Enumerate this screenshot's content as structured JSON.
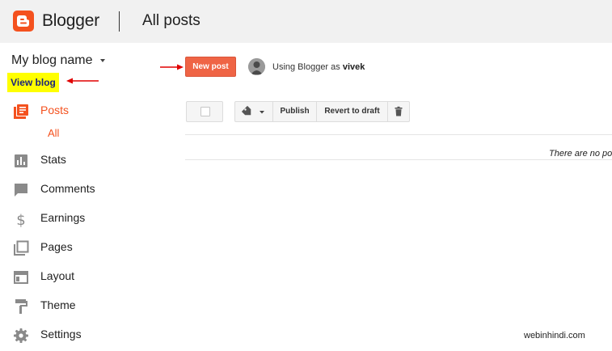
{
  "header": {
    "brand": "Blogger",
    "page_title": "All posts",
    "logo_icon": "blogger-logo-icon",
    "background": "#f1f1f1"
  },
  "sidebar": {
    "blog_name": "My blog name",
    "view_blog": "View blog",
    "items": [
      {
        "label": "Posts",
        "icon": "posts-icon",
        "active": true
      },
      {
        "label": "Stats",
        "icon": "stats-icon",
        "active": false
      },
      {
        "label": "Comments",
        "icon": "comments-icon",
        "active": false
      },
      {
        "label": "Earnings",
        "icon": "dollar-icon",
        "active": false
      },
      {
        "label": "Pages",
        "icon": "pages-icon",
        "active": false
      },
      {
        "label": "Layout",
        "icon": "layout-icon",
        "active": false
      },
      {
        "label": "Theme",
        "icon": "paint-roller-icon",
        "active": false
      },
      {
        "label": "Settings",
        "icon": "gear-icon",
        "active": false
      }
    ],
    "posts_subitem": "All"
  },
  "main": {
    "new_post_label": "New post",
    "using_as_prefix": "Using Blogger as ",
    "username": "vivek",
    "toolbar": {
      "label_icon": "label-tag-icon",
      "publish_label": "Publish",
      "revert_label": "Revert to draft",
      "delete_icon": "trash-icon"
    },
    "empty_message": "There are no posts."
  },
  "watermark": "webinhindi.com",
  "colors": {
    "accent": "#f4511e",
    "new_post_button": "#ef6445",
    "highlight": "#ffff00",
    "annotation_arrow": "#e00000"
  }
}
